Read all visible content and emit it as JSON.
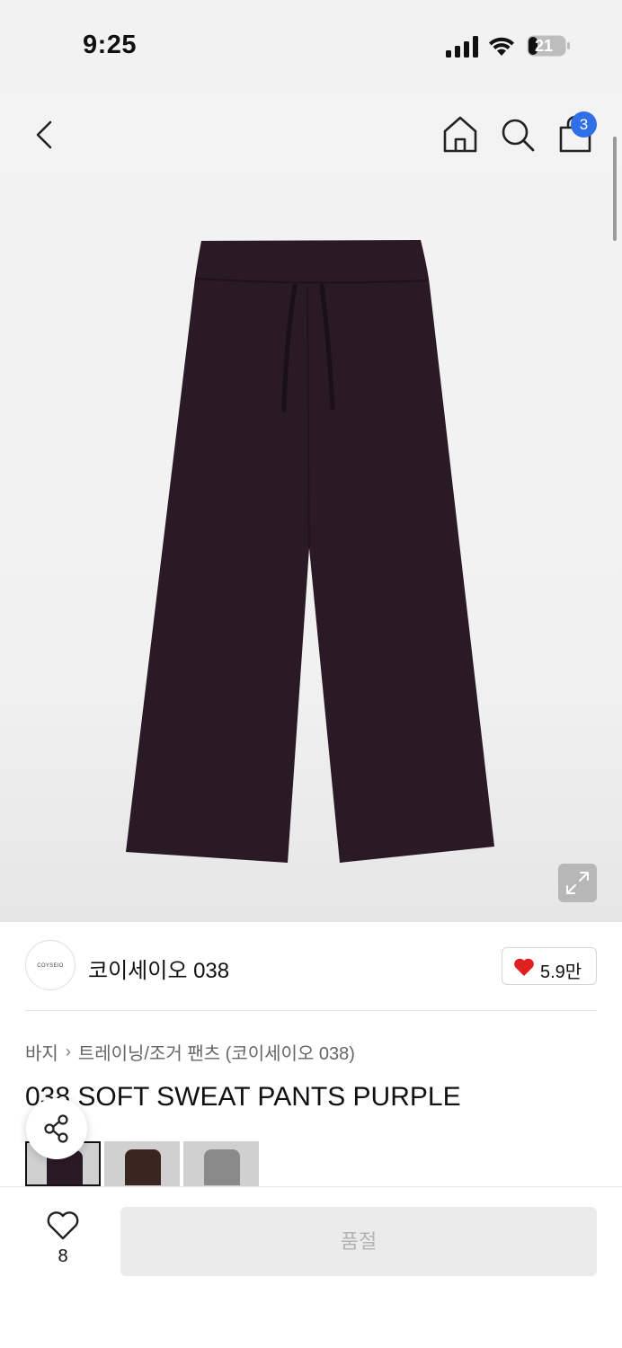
{
  "status": {
    "time": "9:25",
    "battery": "21"
  },
  "header": {
    "icons": [
      "back-icon",
      "home-icon",
      "search-icon",
      "cart-icon",
      "expand-icon"
    ],
    "cart_badge": "3"
  },
  "brand": {
    "logo_text": "COYSEIO",
    "name": "코이세이오 038",
    "like_count": "5.9만"
  },
  "breadcrumb": [
    "바지",
    "트레이닝/조거 팬츠 (코이세이오 038)"
  ],
  "product": {
    "title": "038 SOFT SWEAT PANTS PURPLE"
  },
  "colors": {
    "accent": "#2f6fe8",
    "heart": "#e02020",
    "pants": "#2a1a26"
  },
  "thumbnails": [
    {
      "color": "#2a1a26"
    },
    {
      "color": "#3a2620"
    },
    {
      "color": "#8a8a8a"
    }
  ],
  "bottom": {
    "wish_count": "8",
    "buy_label": "품절"
  }
}
